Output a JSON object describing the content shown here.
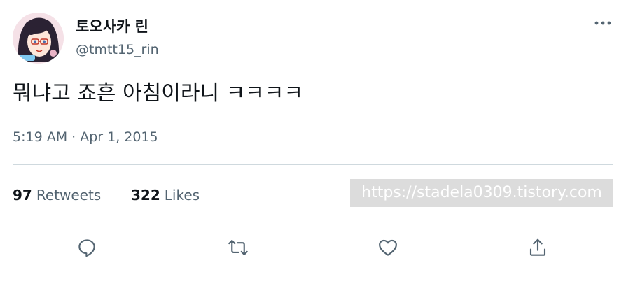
{
  "tweet": {
    "display_name": "토오사카 린",
    "handle": "@tmtt15_rin",
    "text": "뭐냐고 죠흔 아침이라니 ㅋㅋㅋㅋ",
    "timestamp": "5:19 AM · Apr 1, 2015"
  },
  "stats": {
    "retweets_count": "97",
    "retweets_label": "Retweets",
    "likes_count": "322",
    "likes_label": "Likes"
  },
  "watermark": {
    "text": "https://stadela0309.tistory.com"
  },
  "icons": {
    "more": "more-horizontal-icon",
    "reply": "reply-icon",
    "retweet": "retweet-icon",
    "like": "heart-icon",
    "share": "share-icon"
  },
  "colors": {
    "text_primary": "#0f1419",
    "text_secondary": "#536471",
    "divider": "#cfd9de"
  }
}
